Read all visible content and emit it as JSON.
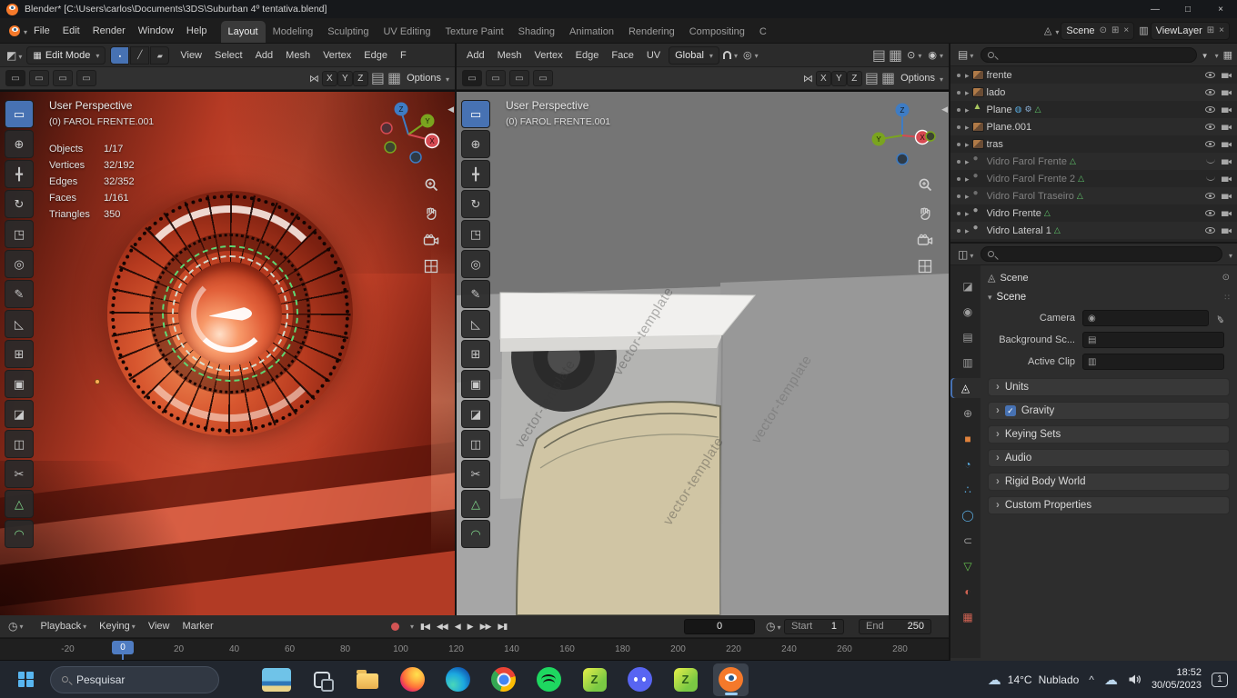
{
  "colors": {
    "accent_blue": "#4772b3",
    "viewport_red": "#c2402c",
    "header_bg": "#2b2b2b",
    "taskbar_bg": "#21262e",
    "playhead_blue": "#4f7cc2"
  },
  "titlebar": {
    "title": "Blender* [C:\\Users\\carlos\\Documents\\3DS\\Suburban 4º tentativa.blend]",
    "minimize_glyph": "—",
    "maximize_glyph": "□",
    "close_glyph": "×"
  },
  "topbar": {
    "menus": [
      {
        "label": "File"
      },
      {
        "label": "Edit"
      },
      {
        "label": "Render"
      },
      {
        "label": "Window"
      },
      {
        "label": "Help"
      }
    ],
    "workspaces": [
      {
        "label": "Layout",
        "flags": [
          "active"
        ]
      },
      {
        "label": "Modeling"
      },
      {
        "label": "Sculpting"
      },
      {
        "label": "UV Editing"
      },
      {
        "label": "Texture Paint"
      },
      {
        "label": "Shading"
      },
      {
        "label": "Animation"
      },
      {
        "label": "Rendering"
      },
      {
        "label": "Compositing"
      },
      {
        "label": "C"
      }
    ],
    "scene_field": "Scene",
    "viewlayer_field": "ViewLayer"
  },
  "viewport_tools": [
    {
      "name": "tool-select-box",
      "glyph": "▭",
      "flags": [
        "active"
      ]
    },
    {
      "name": "tool-cursor",
      "glyph": "⊕"
    },
    {
      "name": "tool-move",
      "glyph": "╋"
    },
    {
      "name": "tool-rotate",
      "glyph": "↻"
    },
    {
      "name": "tool-scale",
      "glyph": "◳"
    },
    {
      "name": "tool-transform",
      "glyph": "◎"
    },
    {
      "name": "tool-annotate",
      "glyph": "✎"
    },
    {
      "name": "tool-measure",
      "glyph": "◺"
    },
    {
      "name": "tool-extrude-region",
      "glyph": "⊞"
    },
    {
      "name": "tool-inset-faces",
      "glyph": "▣"
    },
    {
      "name": "tool-bevel",
      "glyph": "◪"
    },
    {
      "name": "tool-loop-cut",
      "glyph": "◫"
    },
    {
      "name": "tool-knife",
      "glyph": "✂"
    },
    {
      "name": "tool-poly-build",
      "glyph": "△",
      "flags": [
        "green"
      ]
    },
    {
      "name": "tool-spin",
      "glyph": "◠",
      "flags": [
        "green"
      ]
    }
  ],
  "left_viewport": {
    "mode_label": "Edit Mode",
    "menus": [
      {
        "label": "View"
      },
      {
        "label": "Select"
      },
      {
        "label": "Add"
      },
      {
        "label": "Mesh"
      },
      {
        "label": "Vertex"
      },
      {
        "label": "Edge"
      },
      {
        "label": "F"
      }
    ],
    "axis_toggles": [
      {
        "label": "X"
      },
      {
        "label": "Y"
      },
      {
        "label": "Z"
      }
    ],
    "options_label": "Options",
    "overlay": {
      "view_name": "User Perspective",
      "object_name": "(0) FAROL FRENTE.001",
      "stats": [
        {
          "label": "Objects",
          "value": "1/17"
        },
        {
          "label": "Vertices",
          "value": "32/192"
        },
        {
          "label": "Edges",
          "value": "32/352"
        },
        {
          "label": "Faces",
          "value": "1/161"
        },
        {
          "label": "Triangles",
          "value": "350"
        }
      ]
    },
    "gizmo": {
      "x": "X",
      "y": "Y",
      "z": "Z"
    }
  },
  "right_viewport": {
    "menus": [
      {
        "label": "Add"
      },
      {
        "label": "Mesh"
      },
      {
        "label": "Vertex"
      },
      {
        "label": "Edge"
      },
      {
        "label": "Face"
      },
      {
        "label": "UV"
      }
    ],
    "orientation_label": "Global",
    "axis_toggles": [
      {
        "label": "X"
      },
      {
        "label": "Y"
      },
      {
        "label": "Z"
      }
    ],
    "options_label": "Options",
    "overlay": {
      "view_name": "User Perspective",
      "object_name": "(0) FAROL FRENTE.001"
    },
    "watermark": "vector-template",
    "gizmo": {
      "x": "X",
      "y": "Y",
      "z": "Z"
    }
  },
  "outliner": {
    "items": [
      {
        "name": "frente",
        "flags": [
          "ic-image"
        ]
      },
      {
        "name": "lado",
        "flags": [
          "ic-image"
        ]
      },
      {
        "name": "Plane",
        "flags": [
          "ic-mesh",
          "has-physics",
          "has-wrench",
          "has-mesh"
        ]
      },
      {
        "name": "Plane.001",
        "flags": [
          "ic-image"
        ]
      },
      {
        "name": "tras",
        "flags": [
          "ic-image"
        ]
      },
      {
        "name": "Vidro Farol Frente",
        "flags": [
          "ic-material",
          "dimmed",
          "eye-closed",
          "has-mesh"
        ]
      },
      {
        "name": "Vidro Farol Frente 2",
        "flags": [
          "ic-material",
          "dimmed",
          "eye-closed",
          "has-mesh"
        ]
      },
      {
        "name": "Vidro Farol Traseiro",
        "flags": [
          "ic-material",
          "dimmed",
          "has-mesh"
        ]
      },
      {
        "name": "Vidro Frente",
        "flags": [
          "ic-material",
          "has-mesh"
        ]
      },
      {
        "name": "Vidro Lateral 1",
        "flags": [
          "ic-material",
          "has-mesh"
        ]
      }
    ]
  },
  "properties": {
    "tabs": [
      {
        "name": "tab-tool",
        "glyph": "◪"
      },
      {
        "name": "tab-render",
        "glyph": "◉"
      },
      {
        "name": "tab-output",
        "glyph": "▤"
      },
      {
        "name": "tab-view-layer",
        "glyph": "▥"
      },
      {
        "name": "tab-scene",
        "glyph": "◬",
        "flags": [
          "active"
        ]
      },
      {
        "name": "tab-world",
        "glyph": "⊕"
      },
      {
        "name": "tab-object",
        "glyph": "■",
        "flags": [
          "c-orange"
        ]
      },
      {
        "name": "tab-modifiers",
        "glyph": "◔",
        "flags": [
          "c-blue"
        ]
      },
      {
        "name": "tab-particles",
        "glyph": "∴",
        "flags": [
          "c-blue"
        ]
      },
      {
        "name": "tab-physics",
        "glyph": "◯",
        "flags": [
          "c-blue"
        ]
      },
      {
        "name": "tab-constraints",
        "glyph": "⊂"
      },
      {
        "name": "tab-object-data",
        "glyph": "▽",
        "flags": [
          "c-green"
        ]
      },
      {
        "name": "tab-material",
        "glyph": "◐",
        "flags": [
          "c-red"
        ]
      },
      {
        "name": "tab-texture",
        "glyph": "▦",
        "flags": [
          "c-red"
        ]
      }
    ],
    "breadcrumb": "Scene",
    "section_title": "Scene",
    "fields": [
      {
        "label": "Camera",
        "flags": [
          "fi-camera",
          "has-dropper"
        ]
      },
      {
        "label": "Background Sc...",
        "flags": [
          "fi-image"
        ]
      },
      {
        "label": "Active Clip",
        "flags": [
          "fi-film"
        ]
      }
    ],
    "collapsed": [
      {
        "title": "Units"
      },
      {
        "title": "Gravity",
        "flags": [
          "has-checkbox"
        ]
      },
      {
        "title": "Keying Sets"
      },
      {
        "title": "Audio"
      },
      {
        "title": "Rigid Body World"
      },
      {
        "title": "Custom Properties"
      }
    ]
  },
  "timeline": {
    "menus": [
      {
        "label": "Playback",
        "flags": [
          "caret"
        ]
      },
      {
        "label": "Keying",
        "flags": [
          "caret"
        ]
      },
      {
        "label": "View"
      },
      {
        "label": "Marker"
      }
    ],
    "transport": [
      {
        "name": "jump-to-start-button",
        "glyph": "▮◀"
      },
      {
        "name": "prev-keyframe-button",
        "glyph": "◀◀"
      },
      {
        "name": "play-reverse-button",
        "glyph": "◀"
      },
      {
        "name": "play-button",
        "glyph": "▶"
      },
      {
        "name": "next-keyframe-button",
        "glyph": "▶▶"
      },
      {
        "name": "jump-to-end-button",
        "glyph": "▶▮"
      }
    ],
    "current_frame": "0",
    "start_label": "Start",
    "start_value": "1",
    "end_label": "End",
    "end_value": "250",
    "playhead_label": "0",
    "ticks": [
      {
        "label": "-20"
      },
      {
        "label": "0"
      },
      {
        "label": "20"
      },
      {
        "label": "40"
      },
      {
        "label": "60"
      },
      {
        "label": "80"
      },
      {
        "label": "100"
      },
      {
        "label": "120"
      },
      {
        "label": "140"
      },
      {
        "label": "160"
      },
      {
        "label": "180"
      },
      {
        "label": "200"
      },
      {
        "label": "220"
      },
      {
        "label": "240"
      },
      {
        "label": "260"
      },
      {
        "label": "280"
      }
    ]
  },
  "taskbar": {
    "search_label": "Pesquisar",
    "apps": [
      {
        "name": "widgets-button",
        "flags": [
          "widgets"
        ]
      },
      {
        "name": "task-view-button",
        "flags": [
          "taskview"
        ]
      },
      {
        "name": "file-explorer",
        "flags": [
          "folder"
        ]
      },
      {
        "name": "firefox",
        "flags": [
          "firefox"
        ]
      },
      {
        "name": "edge",
        "flags": [
          "edge"
        ]
      },
      {
        "name": "chrome",
        "flags": [
          "chrome"
        ]
      },
      {
        "name": "spotify",
        "flags": [
          "spotify"
        ]
      },
      {
        "name": "z-app",
        "glyph": "Z",
        "flags": [
          "zapp"
        ]
      },
      {
        "name": "discord",
        "flags": [
          "discord"
        ]
      },
      {
        "name": "z-app-2",
        "glyph": "Z",
        "flags": [
          "zapp"
        ]
      },
      {
        "name": "blender",
        "flags": [
          "blender-app",
          "active"
        ]
      }
    ],
    "weather_temp": "14°C",
    "weather_condition": "Nublado",
    "time": "18:52",
    "date": "30/05/2023",
    "notification_count": "1"
  }
}
